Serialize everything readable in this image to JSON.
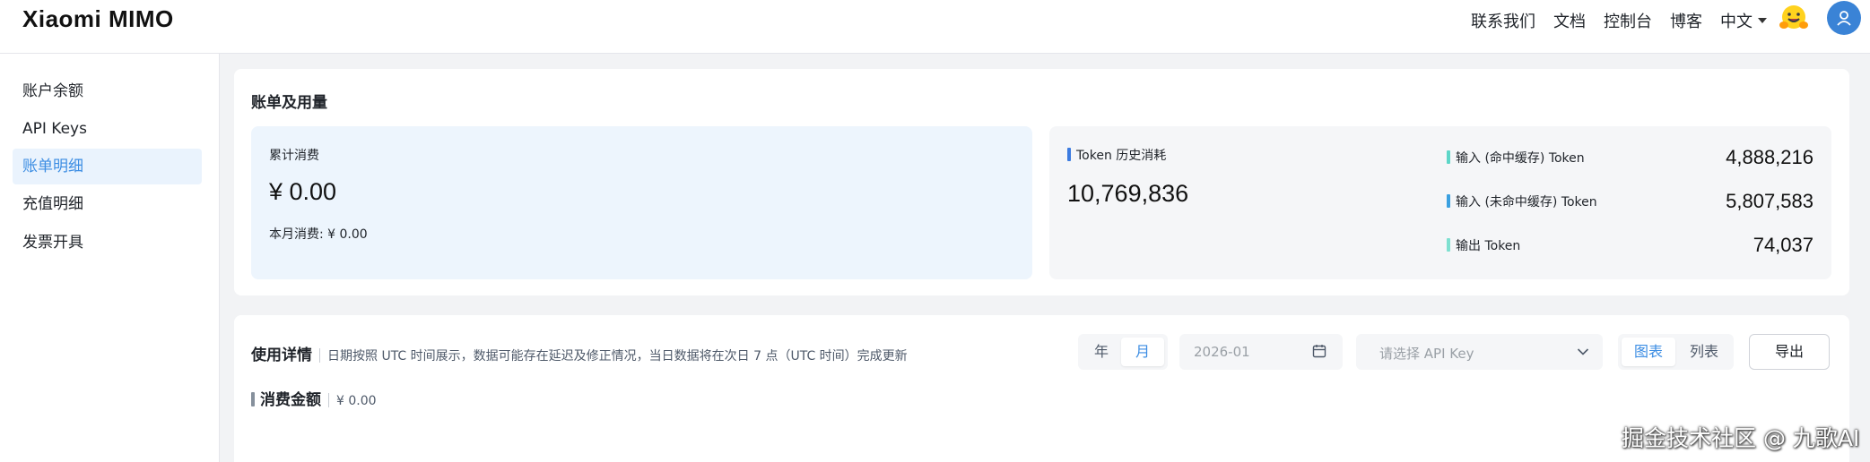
{
  "header": {
    "logo": "Xiaomi MIMO",
    "nav": [
      "联系我们",
      "文档",
      "控制台",
      "博客"
    ],
    "language": "中文"
  },
  "sidebar": {
    "items": [
      {
        "label": "账户余额"
      },
      {
        "label": "API Keys"
      },
      {
        "label": "账单明细"
      },
      {
        "label": "充值明细"
      },
      {
        "label": "发票开具"
      }
    ],
    "active_index": 2
  },
  "billing": {
    "title": "账单及用量",
    "total_label": "累计消费",
    "total_value": "¥ 0.00",
    "month_label": "本月消费: ¥ 0.00",
    "token_history_label": "Token 历史消耗",
    "token_history_value": "10,769,836",
    "breakdown": [
      {
        "label": "输入 (命中缓存) Token",
        "value": "4,888,216",
        "color": "#5dd6c8"
      },
      {
        "label": "输入 (未命中缓存) Token",
        "value": "5,807,583",
        "color": "#3aa0e0"
      },
      {
        "label": "输出 Token",
        "value": "74,037",
        "color": "#7ee0d0"
      }
    ]
  },
  "usage": {
    "title": "使用详情",
    "note": "日期按照 UTC 时间展示，数据可能存在延迟及修正情况，当日数据将在次日 7 点（UTC 时间）完成更新",
    "period_year": "年",
    "period_month": "月",
    "date_value": "2026-01",
    "apikey_placeholder": "请选择 API Key",
    "view_chart": "图表",
    "view_list": "列表",
    "export_label": "导出",
    "spend_label": "消费金额",
    "spend_value": "¥ 0.00"
  },
  "watermark": "掘金技术社区 @ 九歌AI",
  "colors": {
    "accent": "#3c8de3",
    "token_history_bar": "#3c7be0"
  }
}
